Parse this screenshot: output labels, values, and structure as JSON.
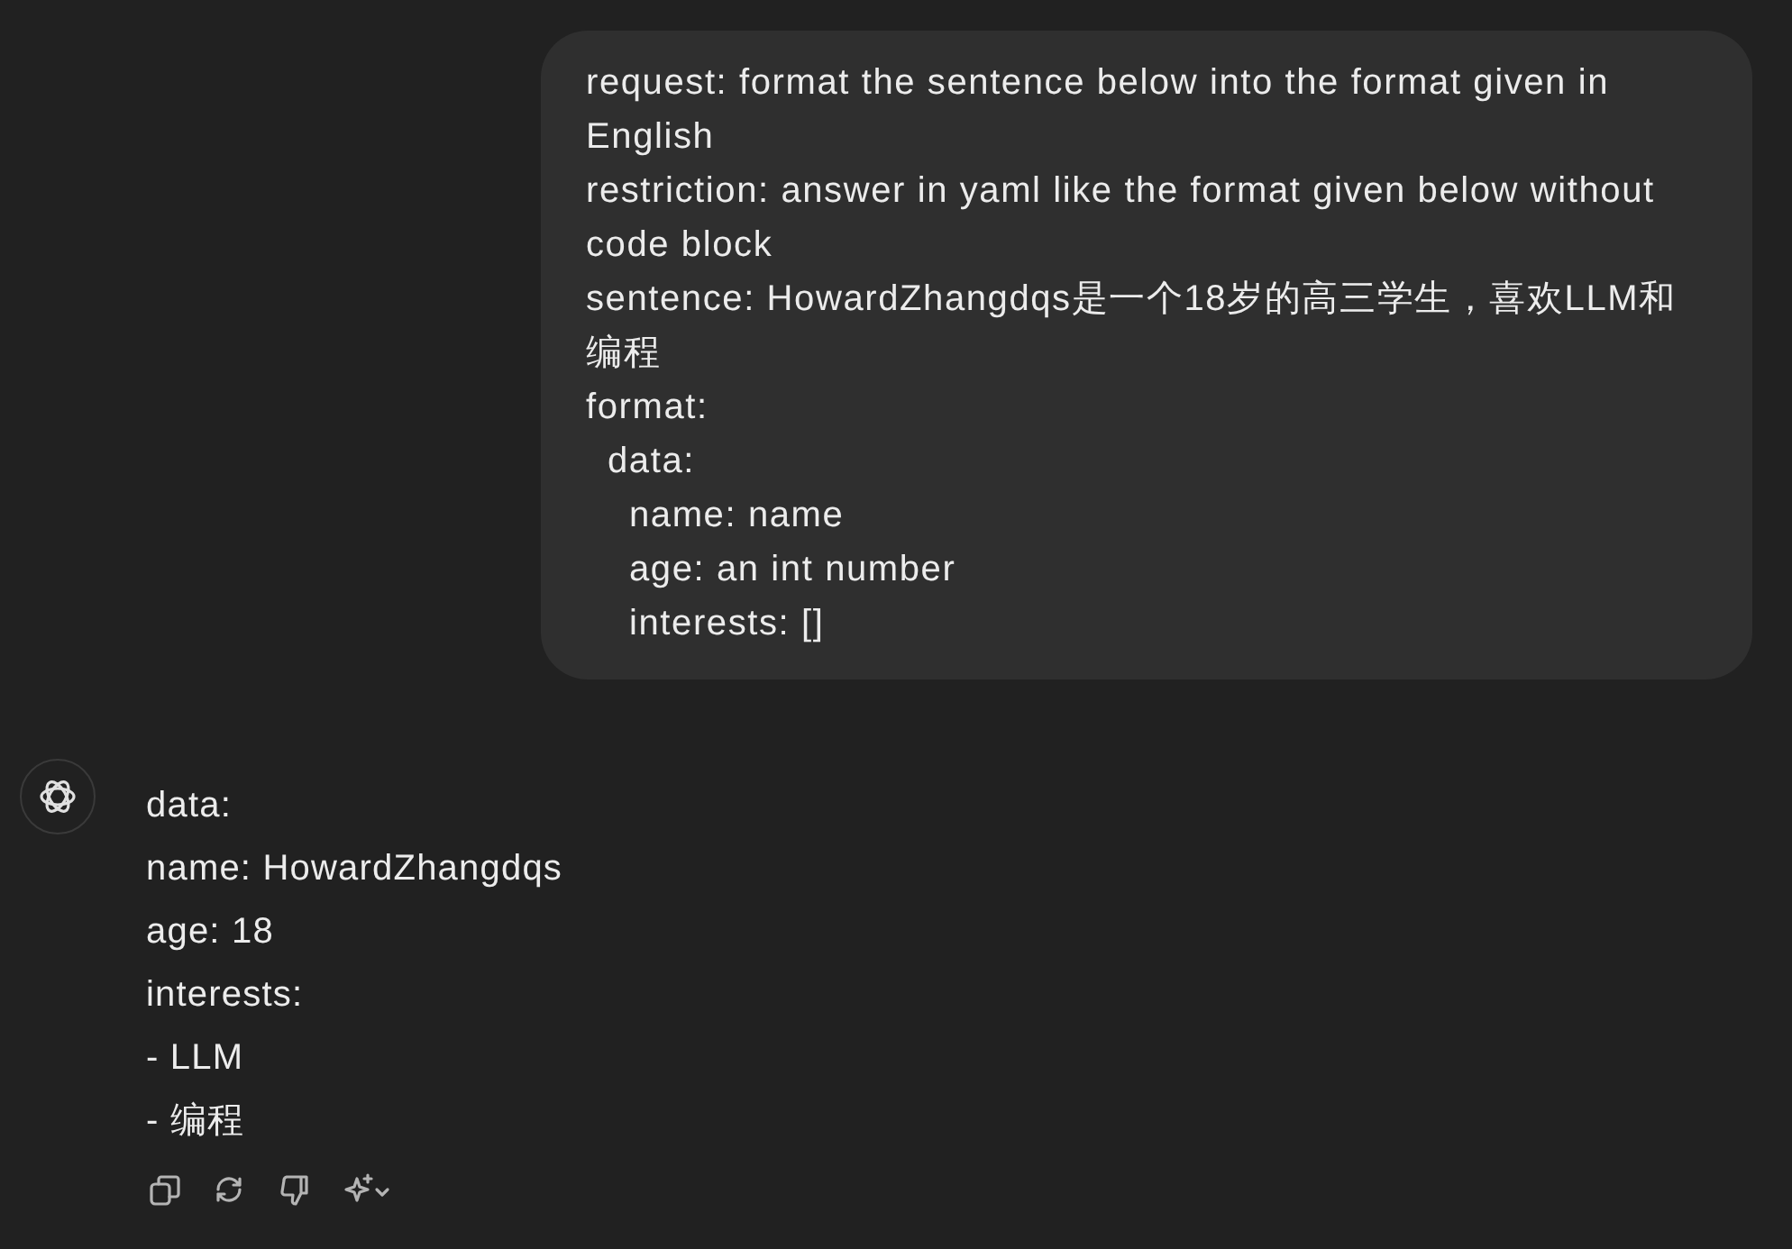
{
  "user_message": {
    "lines": [
      {
        "text": "request: format the sentence below into the format given in English"
      },
      {
        "text": "restriction: answer in yaml like the format given below without code block"
      },
      {
        "text": "sentence: HowardZhangdqs是一个18岁的高三学生，喜欢LLM和编程"
      },
      {
        "text": "format:",
        "children": [
          {
            "text": "data:",
            "children": [
              {
                "text": "name: name"
              },
              {
                "text": "age: an int number"
              },
              {
                "text": "interests: []"
              }
            ]
          }
        ]
      }
    ]
  },
  "assistant_message": {
    "lines": [
      "data:",
      "name: HowardZhangdqs",
      "age: 18",
      "interests:",
      "- LLM",
      "- 编程"
    ],
    "actions": [
      {
        "kind": "copy"
      },
      {
        "kind": "regenerate"
      },
      {
        "kind": "dislike"
      },
      {
        "kind": "model"
      }
    ]
  }
}
